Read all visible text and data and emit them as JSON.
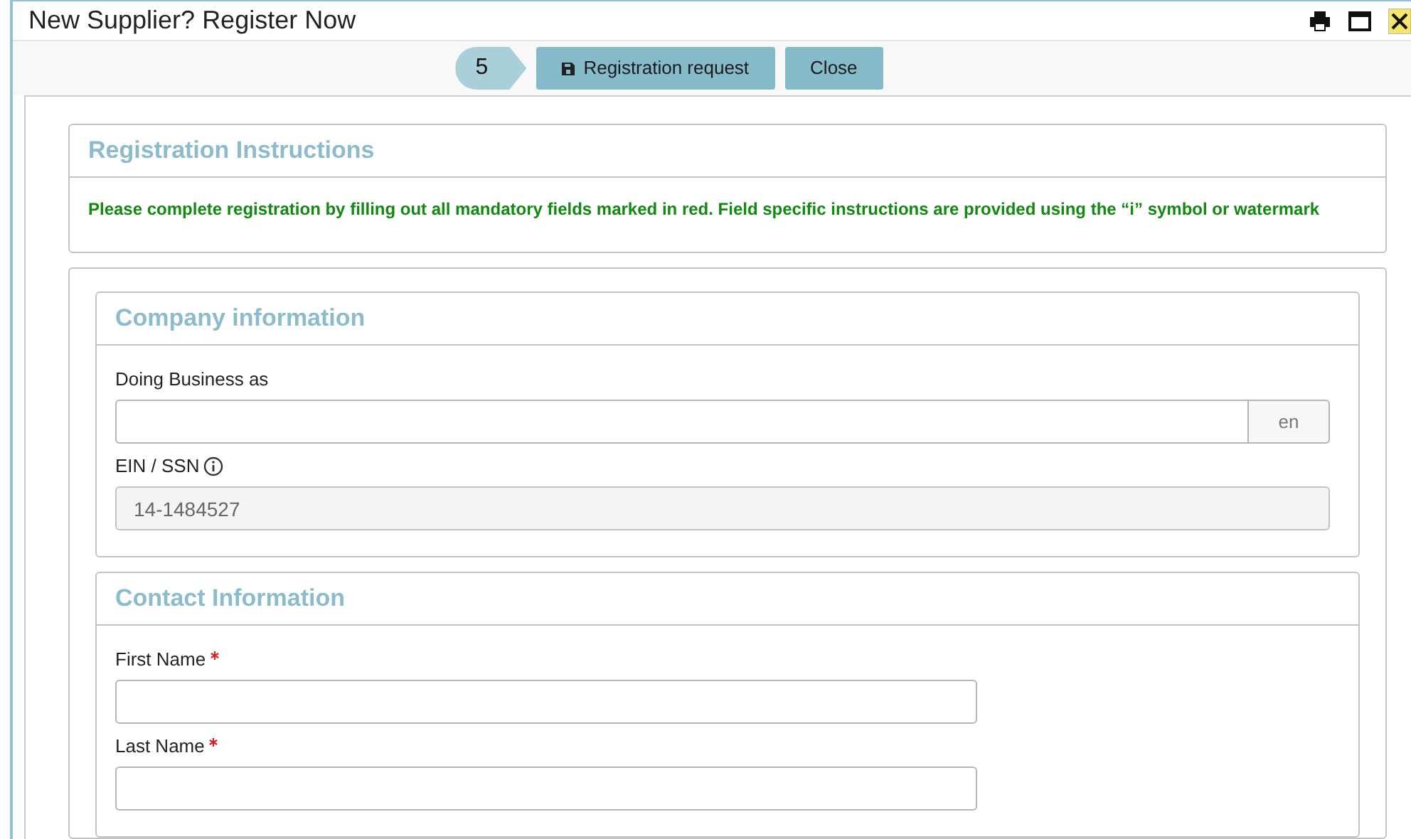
{
  "window": {
    "title": "New Supplier? Register Now"
  },
  "toolbar": {
    "step": "5",
    "buttons": [
      {
        "label": "Registration request",
        "kind": "save"
      },
      {
        "label": "Close",
        "kind": "plain"
      }
    ]
  },
  "instructions": {
    "title": "Registration Instructions",
    "text": "Please complete registration by filling out all mandatory fields marked in red. Field specific instructions are provided using the “i” symbol or watermark"
  },
  "sections": [
    {
      "title": "Company information",
      "fields": [
        {
          "label": "Doing Business as",
          "kind": "text",
          "addon": "en",
          "required": false,
          "info": false
        },
        {
          "label": "EIN / SSN",
          "kind": "readonly",
          "value": "14-1484527",
          "required": false,
          "info": true
        }
      ]
    },
    {
      "title": "Contact Information",
      "fields": [
        {
          "label": "First Name",
          "kind": "short",
          "required": true,
          "info": false
        },
        {
          "label": "Last Name",
          "kind": "short",
          "required": true,
          "info": false
        }
      ]
    }
  ]
}
